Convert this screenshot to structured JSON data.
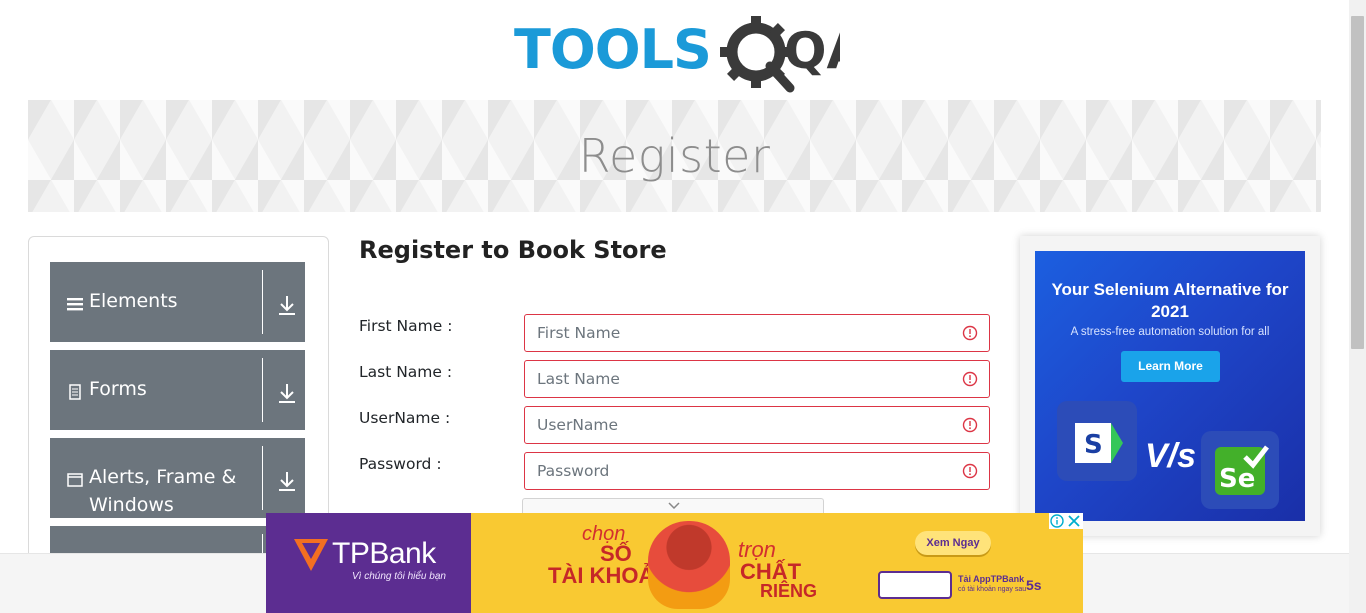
{
  "logo": {
    "text_left": "TOOLS",
    "text_right": "QA",
    "colors": {
      "tools": "#1b9ad8",
      "qa": "#3a3a3a"
    }
  },
  "banner": {
    "title": "Register"
  },
  "sidebar": {
    "groups": [
      {
        "label": "Elements",
        "icon": "hamburger-icon"
      },
      {
        "label": "Forms",
        "icon": "document-icon"
      },
      {
        "label": "Alerts, Frame &",
        "label_line2": "Windows",
        "icon": "window-icon"
      },
      {
        "label": "",
        "icon": ""
      }
    ],
    "color": "#6c757d"
  },
  "form": {
    "title": "Register to Book Store",
    "fields": [
      {
        "label": "First Name :",
        "placeholder": "First Name",
        "value": ""
      },
      {
        "label": "Last Name :",
        "placeholder": "Last Name",
        "value": ""
      },
      {
        "label": "UserName :",
        "placeholder": "UserName",
        "value": ""
      },
      {
        "label": "Password :",
        "placeholder": "Password",
        "value": ""
      }
    ],
    "error_color": "#dc3545"
  },
  "ad_right": {
    "headline": "Your Selenium Alternative for 2021",
    "subline": "A stress-free automation solution for all",
    "cta": "Learn More",
    "vs": "V/s"
  },
  "ad_bottom": {
    "brand": "TPBank",
    "tagline": "Vì chúng tôi hiểu bạn",
    "line1": "chọn",
    "line2": "SỐ",
    "line3": "TÀI KHOẢN",
    "line4": "trọn",
    "line5": "CHẤT",
    "line6": "RIÊNG",
    "cta": "Xem Ngay",
    "app_text": "Tải AppTPBank",
    "app_sub": "có tài khoản ngay sau",
    "timer": "5s",
    "colors": {
      "brand": "#5c2d91",
      "background": "#f9c932"
    }
  }
}
